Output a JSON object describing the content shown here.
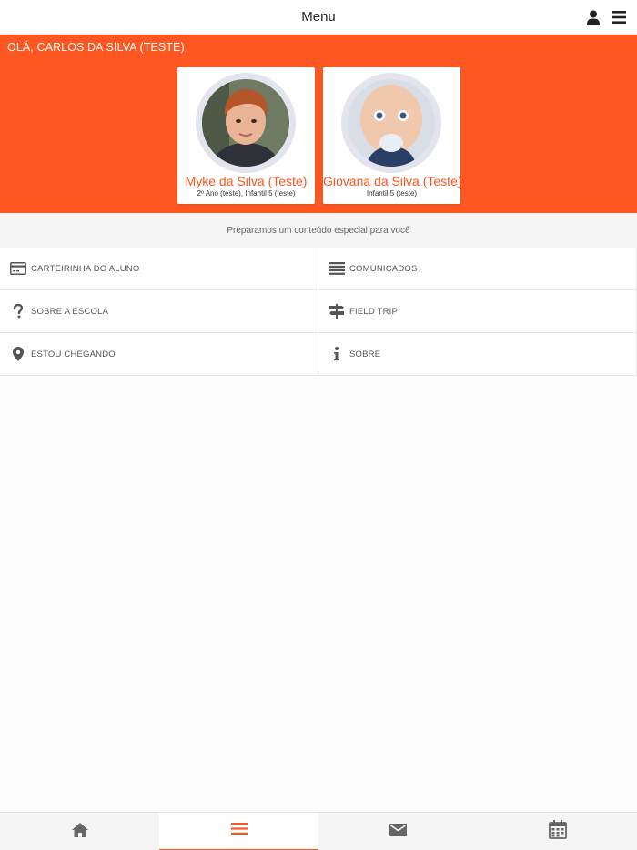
{
  "header": {
    "title": "Menu",
    "user_icon": "user-icon",
    "menu_icon": "hamburger-menu-icon"
  },
  "hero": {
    "greeting": "OLÁ, CARLOS DA SILVA (TESTE)",
    "background": "#ff5722"
  },
  "students": [
    {
      "name": "Myke da Silva (Teste)",
      "class": "2º Ano (teste), Infantil 5 (teste)"
    },
    {
      "name": "Giovana da Silva (Teste)",
      "class": "Infantil 5 (teste)"
    }
  ],
  "subtitle": "Preparamos um conteúdo especial para você",
  "menu": {
    "items": [
      {
        "label": "CARTEIRINHA DO ALUNO",
        "icon": "credit-card-icon"
      },
      {
        "label": "COMUNICADOS",
        "icon": "list-icon"
      },
      {
        "label": "SOBRE A ESCOLA",
        "icon": "question-icon"
      },
      {
        "label": "FIELD TRIP",
        "icon": "signpost-icon"
      },
      {
        "label": "ESTOU CHEGANDO",
        "icon": "map-pin-icon"
      },
      {
        "label": "SOBRE",
        "icon": "info-icon"
      }
    ]
  },
  "bottom_nav": {
    "tabs": [
      {
        "icon": "home-icon"
      },
      {
        "icon": "hamburger-menu-icon",
        "active": true
      },
      {
        "icon": "envelope-icon"
      },
      {
        "icon": "calendar-icon"
      }
    ]
  },
  "colors": {
    "accent": "#ff5722",
    "text": "#555555"
  }
}
